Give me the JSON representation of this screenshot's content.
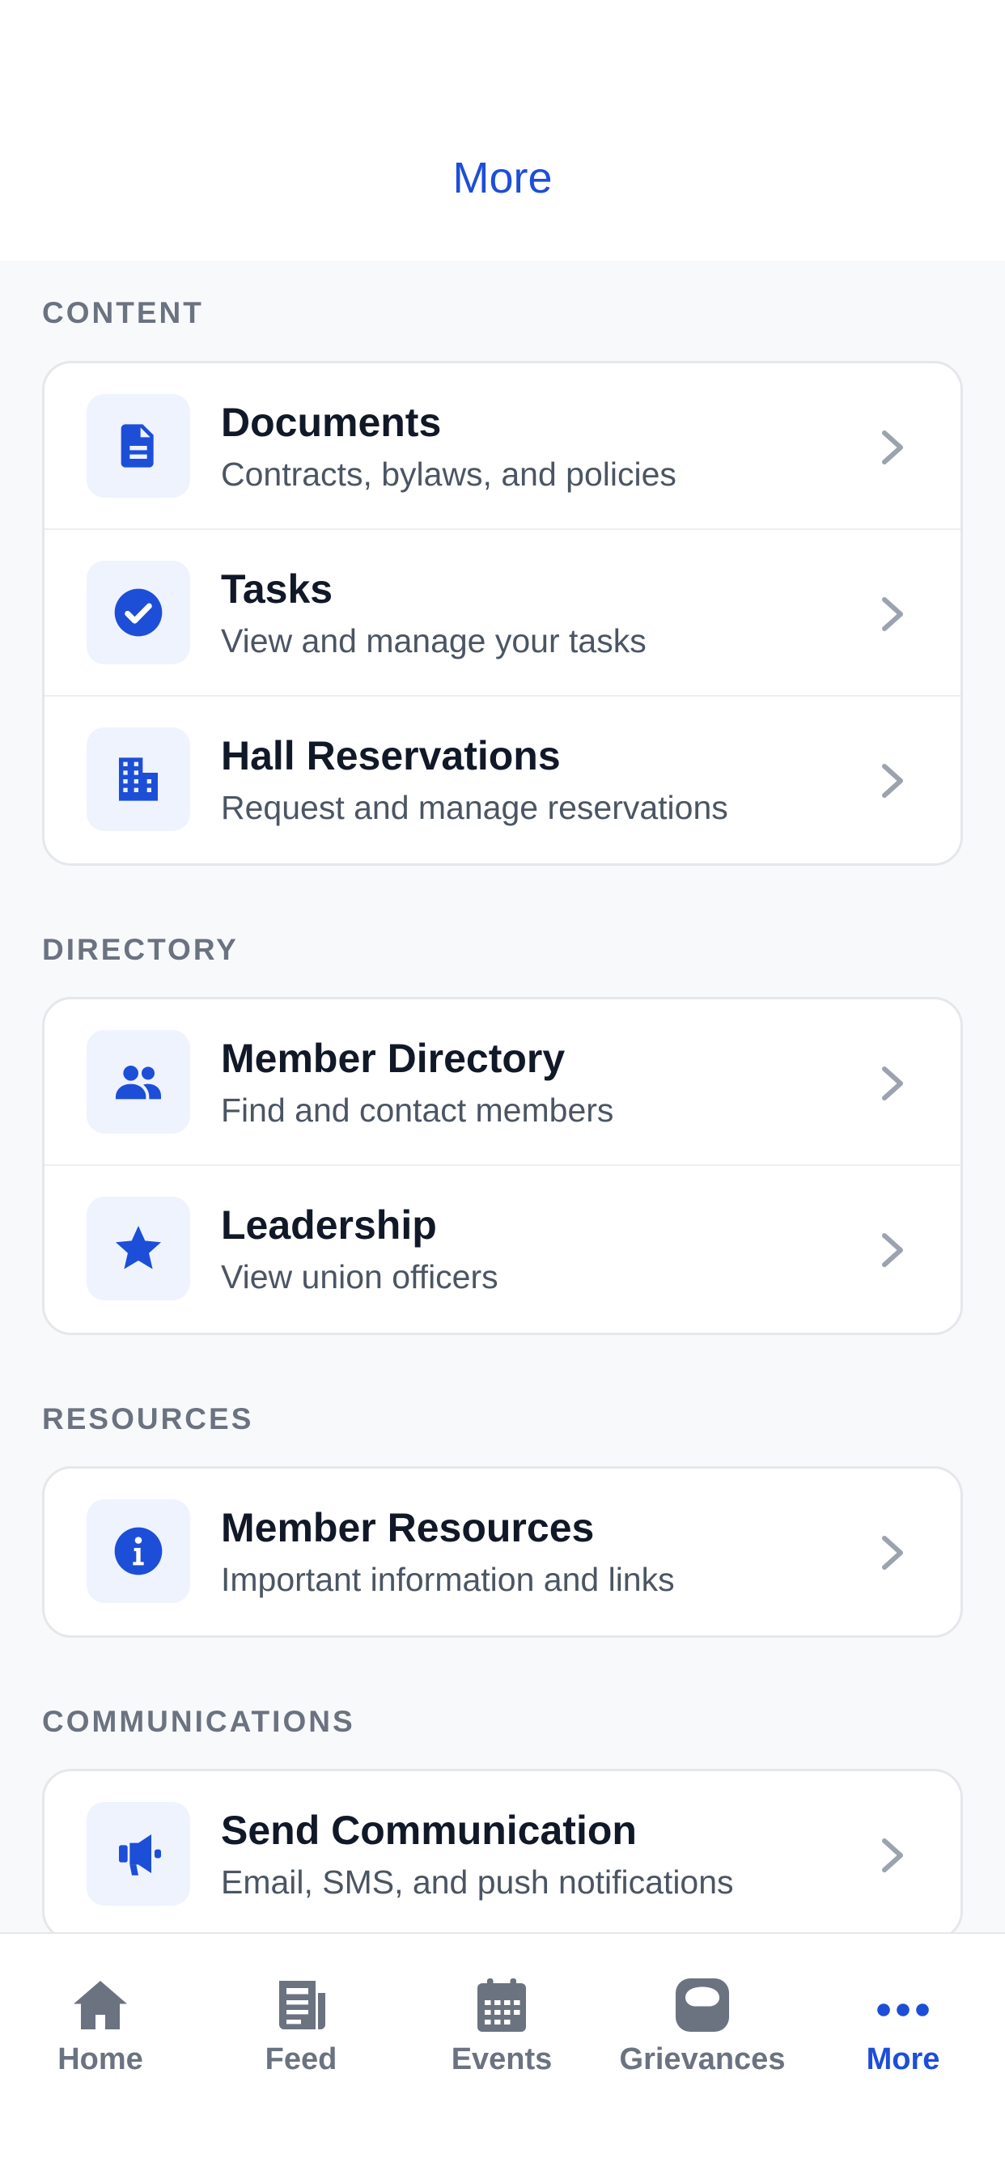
{
  "header": {
    "title": "More"
  },
  "colors": {
    "accent": "#1d4ed8",
    "icon_bg": "#eef3fe",
    "muted": "#6b7280",
    "text": "#111827"
  },
  "sections": [
    {
      "label": "CONTENT",
      "items": [
        {
          "title": "Documents",
          "subtitle": "Contracts, bylaws, and policies",
          "icon": "document-icon"
        },
        {
          "title": "Tasks",
          "subtitle": "View and manage your tasks",
          "icon": "check-circle-icon"
        },
        {
          "title": "Hall Reservations",
          "subtitle": "Request and manage reservations",
          "icon": "building-icon"
        }
      ]
    },
    {
      "label": "DIRECTORY",
      "items": [
        {
          "title": "Member Directory",
          "subtitle": "Find and contact members",
          "icon": "users-icon"
        },
        {
          "title": "Leadership",
          "subtitle": "View union officers",
          "icon": "star-icon"
        }
      ]
    },
    {
      "label": "RESOURCES",
      "items": [
        {
          "title": "Member Resources",
          "subtitle": "Important information and links",
          "icon": "info-icon"
        }
      ]
    },
    {
      "label": "COMMUNICATIONS",
      "items": [
        {
          "title": "Send Communication",
          "subtitle": "Email, SMS, and push notifications",
          "icon": "megaphone-icon"
        }
      ]
    }
  ],
  "tabbar": {
    "tabs": [
      {
        "label": "Home",
        "icon": "home-icon",
        "active": false
      },
      {
        "label": "Feed",
        "icon": "newspaper-icon",
        "active": false
      },
      {
        "label": "Events",
        "icon": "calendar-icon",
        "active": false
      },
      {
        "label": "Grievances",
        "icon": "grievance-icon",
        "active": false
      },
      {
        "label": "More",
        "icon": "more-dots-icon",
        "active": true
      }
    ]
  }
}
